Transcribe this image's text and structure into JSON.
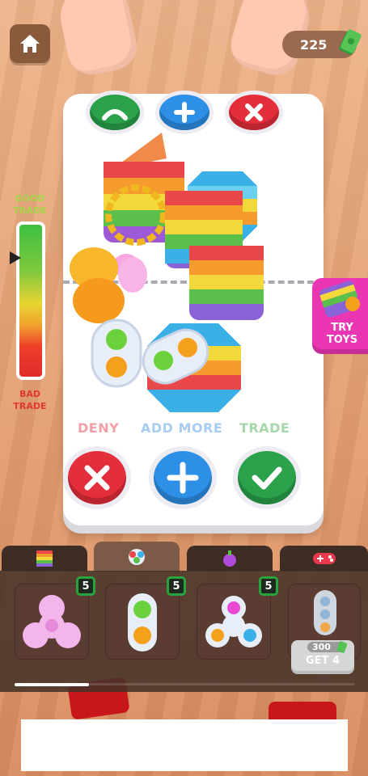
{
  "hud": {
    "home_icon": "home-icon",
    "money": "225",
    "money_icon": "cash-icon"
  },
  "meter": {
    "top_label": "GOOD TRADE",
    "bottom_label": "BAD TRADE",
    "level": 0.77
  },
  "board": {
    "buttons": {
      "deny": "DENY",
      "add_more": "ADD MORE",
      "trade": "TRADE"
    }
  },
  "try_toys": {
    "label": "TRY TOYS"
  },
  "tabs": [
    {
      "icon": "pop-it-icon",
      "active": false
    },
    {
      "icon": "simple-dimple-icon",
      "active": true
    },
    {
      "icon": "squishy-icon",
      "active": false
    },
    {
      "icon": "gamepad-icon",
      "active": false
    }
  ],
  "inventory": [
    {
      "icon": "pink-spinner-icon",
      "count": "5"
    },
    {
      "icon": "simple-dimple-icon",
      "count": "5"
    },
    {
      "icon": "white-spinner-icon",
      "count": "5"
    },
    {
      "icon": "locked-toy-icon",
      "price": "300",
      "action": "GET 4"
    }
  ],
  "colors": {
    "deny": "#e52e3b",
    "add": "#2d8fe6",
    "trade": "#2aa14a",
    "try_toys": "#ea36b2",
    "count_border": "#29a33d"
  }
}
